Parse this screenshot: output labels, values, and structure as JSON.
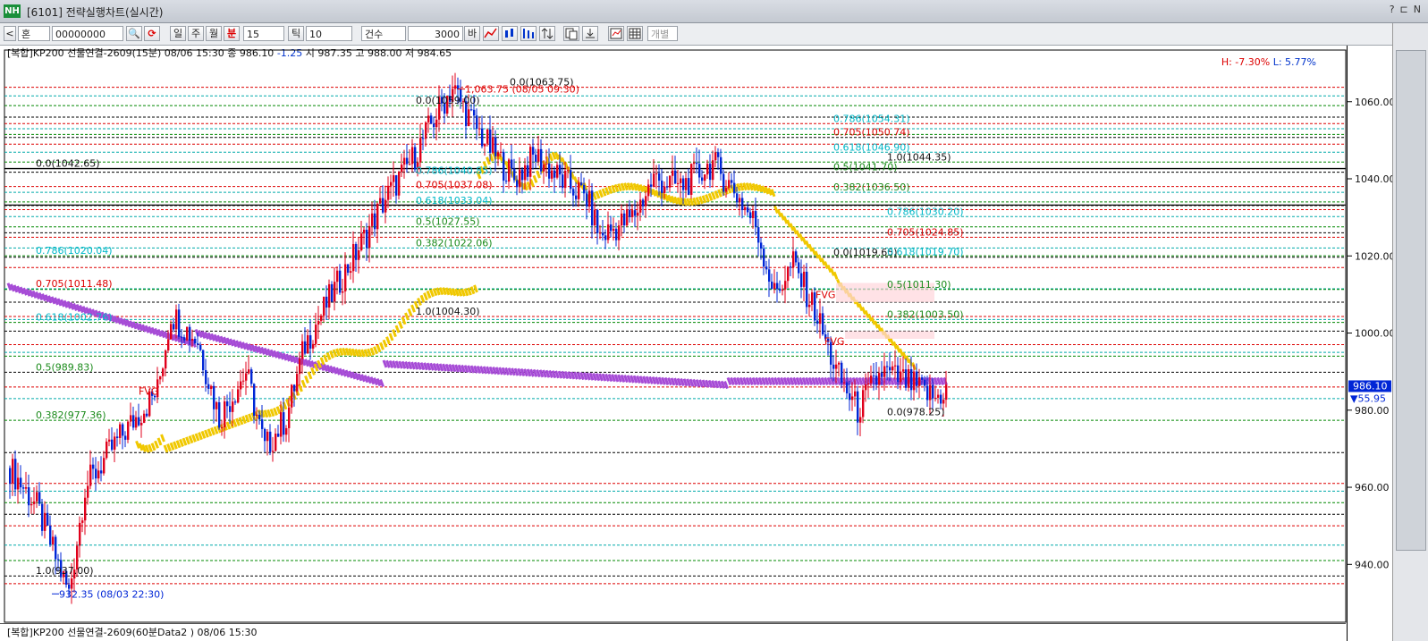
{
  "window": {
    "logo": "NH",
    "title": "[6101] 전략실행차트(실시간)",
    "ctrl_help": "?",
    "ctrl_layout": "⊏",
    "ctrl_nav": "N"
  },
  "toolbar": {
    "collapse": "<",
    "market": "혼",
    "code": "00000000",
    "search_glyph": "🔍",
    "refresh_glyph": "⟳",
    "period_day": "일",
    "period_week": "주",
    "period_month": "월",
    "period_minute": "분",
    "interval": "15",
    "period_tick": "틱",
    "tick": "10",
    "count_label": "건수",
    "count": "3000",
    "count_unit": "바",
    "individual": "개별"
  },
  "status": {
    "instrument": "[복합]KP200 선물연결-2609(15분) 08/06 15:30",
    "close": "종 986.10",
    "change": "-1.25",
    "ohl": "시 987.35 고 988.00 저 984.65",
    "high_pct": "H: -7.30%",
    "low_pct": "L: 5.77%"
  },
  "pane2": {
    "title": "[복합]KP200 선물연결-2609(60분Data2 ) 08/06 15:30"
  },
  "axis": {
    "last_price": "986.10",
    "last_change": "▼55.95"
  },
  "chart_data": {
    "type": "candlestick",
    "ylim": [
      925,
      1072
    ],
    "yticks": [
      940,
      960,
      980,
      1000,
      1020,
      1040,
      1060
    ],
    "ytick_labels": [
      "940.00",
      "960.00",
      "980.00",
      "1000.00",
      "1020.00",
      "1040.00",
      "1060.00"
    ],
    "high_marker": "1,063.75 (08/05 09:30)",
    "low_marker": "932.35 (08/03 22:30)",
    "fib_labels": [
      "0.0(1063.75)",
      "0.786(1054.31)",
      "0.705(1050.74)",
      "0.618(1046.90)",
      "1.0(1044.35)",
      "0.5(1041.70)",
      "0.382(1036.50)",
      "0.786(1030.20)",
      "0.705(1024.85)",
      "0.0(1019.65)",
      "0.618(1019.70)",
      "0.5(1011.30)",
      "0.382(1003.50)",
      "0.0(978.25)",
      "0.0(1042.65)",
      "0.786(1020.04)",
      "0.705(1011.48)",
      "0.618(1002.76)",
      "0.5(989.83)",
      "0.382(977.36)",
      "1.0(937.00)",
      "1.0(1004.30)",
      "0.5(1027.55)",
      "0.382(1022.06)",
      "0.618(1033.04)",
      "0.705(1037.08)",
      "0.786(1040.85)",
      "0.0(1059.00)"
    ],
    "fvg_label": "FVG",
    "series": [
      {
        "name": "price",
        "style": "candles",
        "ohlc": []
      }
    ]
  }
}
